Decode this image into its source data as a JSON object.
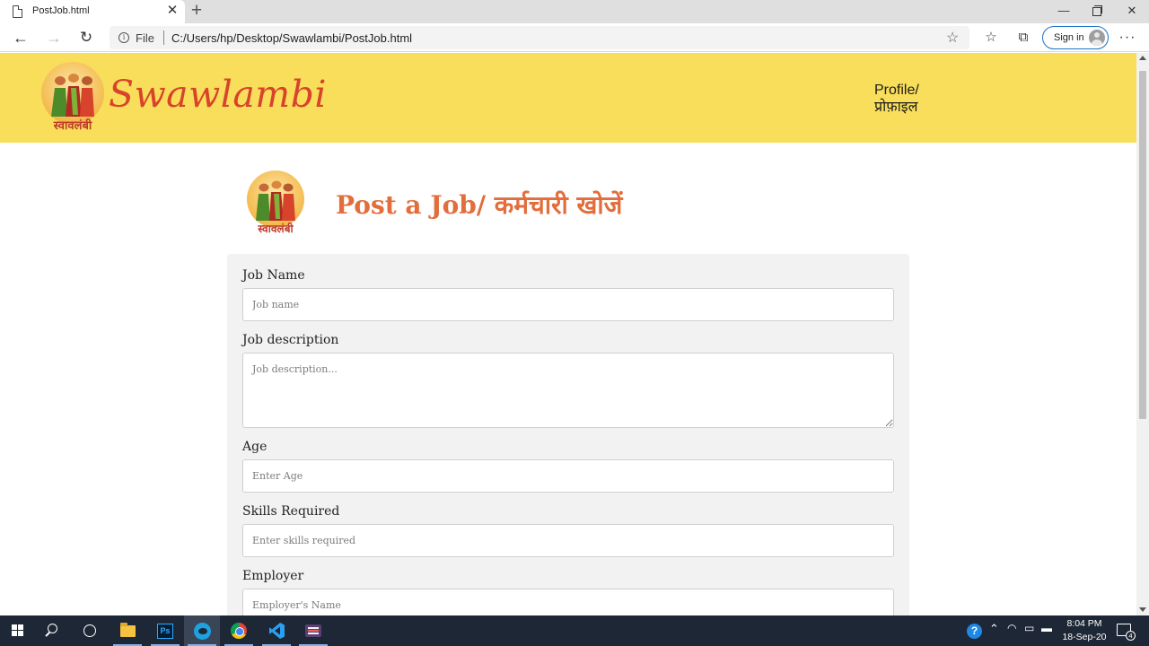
{
  "browser": {
    "tab_title": "PostJob.html",
    "tab_close": "✕",
    "new_tab": "+",
    "address_prefix": "File",
    "url": "C:/Users/hp/Desktop/Swawlambi/PostJob.html",
    "sign_in": "Sign in",
    "more_icon": "···",
    "window_controls": {
      "minimize": "—",
      "close": "✕"
    }
  },
  "site": {
    "brand": "Swawlambi",
    "logo_caption": "स्वावलंबी",
    "profile_line1": "Profile/",
    "profile_line2": "प्रोफ़ाइल",
    "header_color": "#f8de5a",
    "brand_color": "#d8432b"
  },
  "page": {
    "title": "Post a Job/ कर्मचारी खोजें",
    "title_color": "#e26e3c"
  },
  "form": {
    "job_name": {
      "label": "Job Name",
      "placeholder": "Job name"
    },
    "job_description": {
      "label": "Job description",
      "placeholder": "Job description..."
    },
    "age": {
      "label": "Age",
      "placeholder": "Enter Age"
    },
    "skills": {
      "label": "Skills Required",
      "placeholder": "Enter skills required"
    },
    "employer": {
      "label": "Employer",
      "placeholder": "Employer's Name"
    }
  },
  "taskbar": {
    "apps": [
      "windows-start",
      "search",
      "cortana",
      "file-explorer",
      "photoshop",
      "edge",
      "chrome",
      "vscode",
      "app"
    ],
    "ps_label": "Ps",
    "help_label": "?",
    "time": "8:04 PM",
    "date": "18-Sep-20",
    "notification_count": "4"
  }
}
